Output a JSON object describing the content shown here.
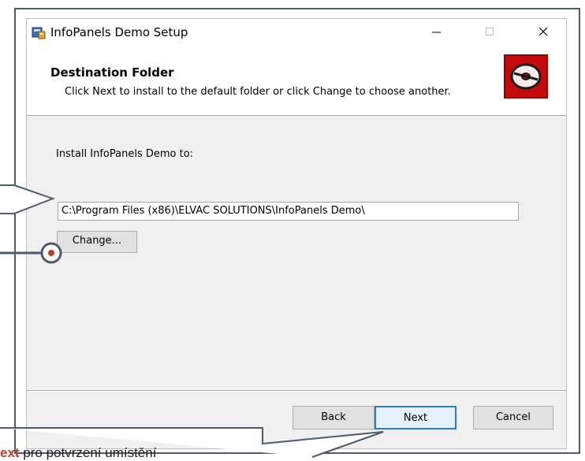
{
  "window": {
    "title": "InfoPanels Demo Setup",
    "minimize_glyph": "—",
    "close_glyph": "✕"
  },
  "header": {
    "title": "Destination Folder",
    "subtitle": "Click Next to install to the default folder or click Change to choose another."
  },
  "content": {
    "install_label": "Install InfoPanels Demo to:",
    "install_path": "C:\\Program Files (x86)\\ELVAC SOLUTIONS\\InfoPanels Demo\\",
    "change_label": "Change..."
  },
  "footer": {
    "back_label": "Back",
    "next_label": "Next",
    "cancel_label": "Cancel"
  },
  "annotation": {
    "bottom_prefix": "",
    "bottom_highlight": "ext",
    "bottom_rest": " pro potvrzení umístění"
  },
  "colors": {
    "callout": "#4f5b6b",
    "highlight": "#c0392b",
    "banner": "#c40a0a",
    "focus": "#2f78d5"
  }
}
